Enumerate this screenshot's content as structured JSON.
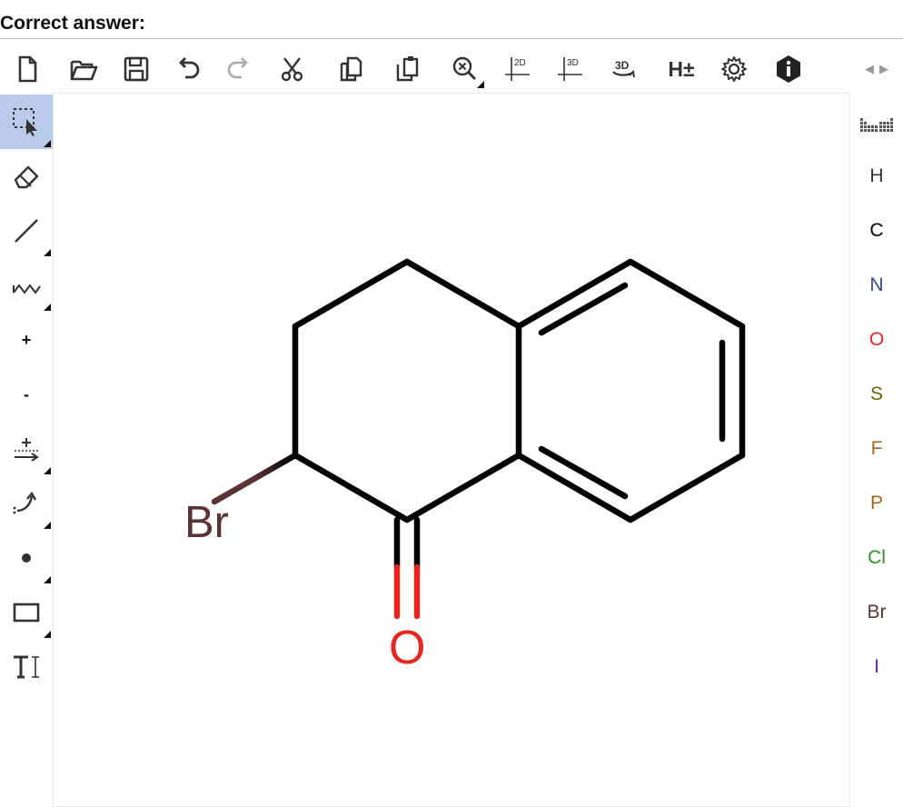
{
  "heading": "Correct answer:",
  "toolbar_text": {
    "hydrogens": "H±",
    "two_d": "2D",
    "three_d": "3D",
    "view_3d": "3D"
  },
  "left_tools_text": {
    "charge_plus": "+",
    "charge_minus": "-"
  },
  "molecule": {
    "bromine": "Br",
    "oxygen": "O"
  },
  "elements": [
    {
      "symbol": "H",
      "color": "#333333"
    },
    {
      "symbol": "C",
      "color": "#000000"
    },
    {
      "symbol": "N",
      "color": "#304ba3"
    },
    {
      "symbol": "O",
      "color": "#e6251f"
    },
    {
      "symbol": "S",
      "color": "#6d6500"
    },
    {
      "symbol": "F",
      "color": "#a06b1e"
    },
    {
      "symbol": "P",
      "color": "#a16a17"
    },
    {
      "symbol": "Cl",
      "color": "#2a9222"
    },
    {
      "symbol": "Br",
      "color": "#5a3434"
    },
    {
      "symbol": "I",
      "color": "#6a1fa8"
    }
  ],
  "colors": {
    "bond": "#000000",
    "bromine": "#5a3434",
    "oxygen": "#e6251f",
    "active_tool": "#b9cbe8"
  }
}
